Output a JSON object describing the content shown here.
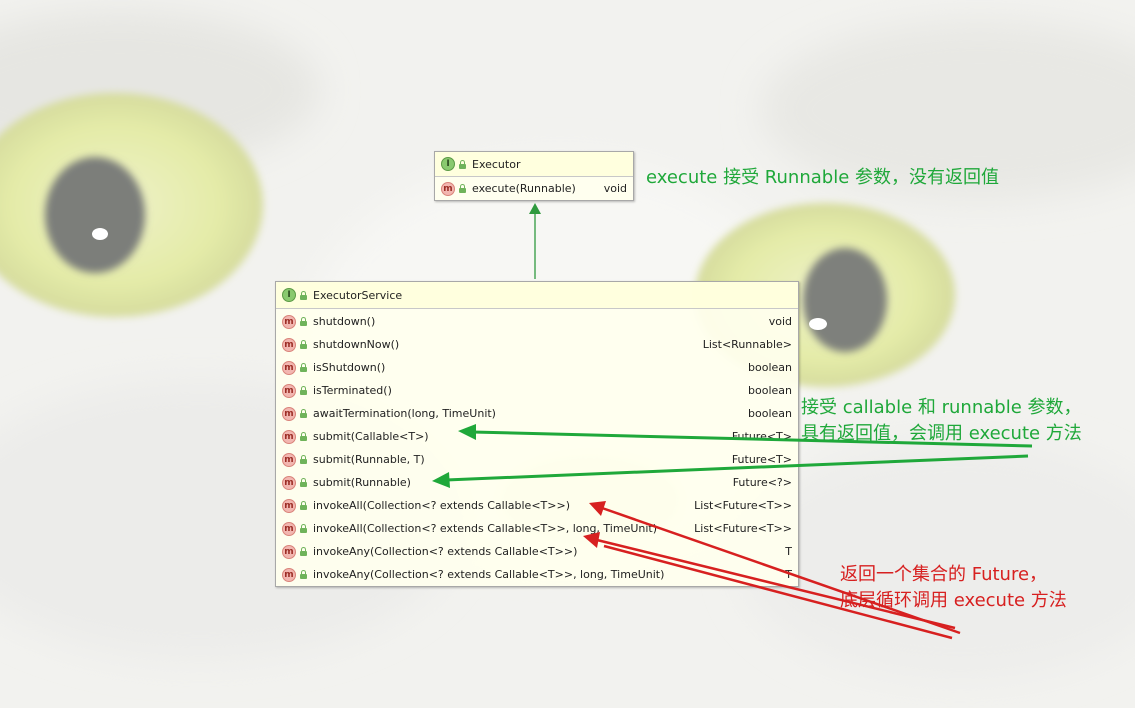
{
  "colors": {
    "green_accent": "#1fa83a",
    "red_accent": "#d72020",
    "interface_icon": "#8ac96f",
    "method_icon": "#f2b6b0"
  },
  "executor": {
    "title": "Executor",
    "icon": "interface-icon",
    "methods": [
      {
        "name": "execute(Runnable)",
        "returns": "void"
      }
    ]
  },
  "executor_service": {
    "title": "ExecutorService",
    "icon": "interface-icon",
    "methods": [
      {
        "name": "shutdown()",
        "returns": "void"
      },
      {
        "name": "shutdownNow()",
        "returns": "List<Runnable>"
      },
      {
        "name": "isShutdown()",
        "returns": "boolean"
      },
      {
        "name": "isTerminated()",
        "returns": "boolean"
      },
      {
        "name": "awaitTermination(long, TimeUnit)",
        "returns": "boolean"
      },
      {
        "name": "submit(Callable<T>)",
        "returns": "Future<T>"
      },
      {
        "name": "submit(Runnable, T)",
        "returns": "Future<T>"
      },
      {
        "name": "submit(Runnable)",
        "returns": "Future<?>"
      },
      {
        "name": "invokeAll(Collection<? extends Callable<T>>)",
        "returns": "List<Future<T>>"
      },
      {
        "name": "invokeAll(Collection<? extends Callable<T>>, long, TimeUnit)",
        "returns": "List<Future<T>>"
      },
      {
        "name": "invokeAny(Collection<? extends Callable<T>>)",
        "returns": "T"
      },
      {
        "name": "invokeAny(Collection<? extends Callable<T>>, long, TimeUnit)",
        "returns": "T"
      }
    ]
  },
  "annotations": {
    "execute_note": "execute 接受 Runnable 参数，没有返回值",
    "submit_note_line1": "接受  callable 和 runnable 参数，",
    "submit_note_line2": "具有返回值，会调用 execute 方法",
    "invoke_note_line1": "返回一个集合的 Future，",
    "invoke_note_line2": "底层循环调用 execute 方法"
  }
}
